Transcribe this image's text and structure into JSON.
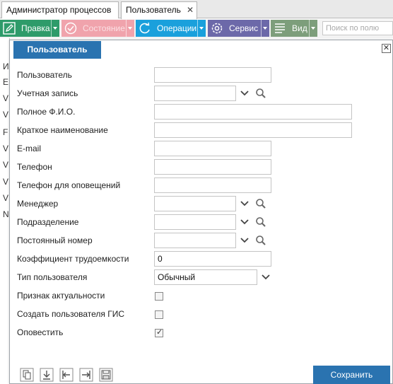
{
  "tabs": [
    {
      "label": "Администратор процессов"
    },
    {
      "label": "Пользователь",
      "close": "✕"
    }
  ],
  "toolbar": {
    "edit": "Правка",
    "state": "Состояние",
    "operations": "Операции",
    "service": "Сервис",
    "view": "Вид",
    "search_placeholder": "Поиск по полю"
  },
  "background_list": [
    "И",
    "E",
    "V",
    "V",
    "F",
    "V",
    "V",
    "V",
    "V",
    "N"
  ],
  "dialog": {
    "title": "Пользователь",
    "close": "✕",
    "fields": {
      "user": {
        "label": "Пользователь",
        "value": ""
      },
      "account": {
        "label": "Учетная запись",
        "value": ""
      },
      "full_name": {
        "label": "Полное Ф.И.О.",
        "value": ""
      },
      "short_name": {
        "label": "Краткое наименование",
        "value": ""
      },
      "email": {
        "label": "E-mail",
        "value": ""
      },
      "phone": {
        "label": "Телефон",
        "value": ""
      },
      "notify_phone": {
        "label": "Телефон для оповещений",
        "value": ""
      },
      "manager": {
        "label": "Менеджер",
        "value": ""
      },
      "department": {
        "label": "Подразделение",
        "value": ""
      },
      "permanent_number": {
        "label": "Постоянный номер",
        "value": ""
      },
      "labor_coefficient": {
        "label": "Коэффициент трудоемкости",
        "value": "0"
      },
      "user_type": {
        "label": "Тип пользователя",
        "value": "Обычный"
      },
      "is_actual": {
        "label": "Признак актуальности",
        "checked": false
      },
      "create_gis_user": {
        "label": "Создать пользователя ГИС",
        "checked": false
      },
      "notify": {
        "label": "Оповестить",
        "checked": true
      }
    },
    "save_label": "Сохранить"
  },
  "colors": {
    "edit": "#2e9b6a",
    "state": "#f0a3ac",
    "operations": "#1aa0dc",
    "service": "#6c69a9",
    "view": "#7d9e7b",
    "primary": "#2a73b0"
  }
}
